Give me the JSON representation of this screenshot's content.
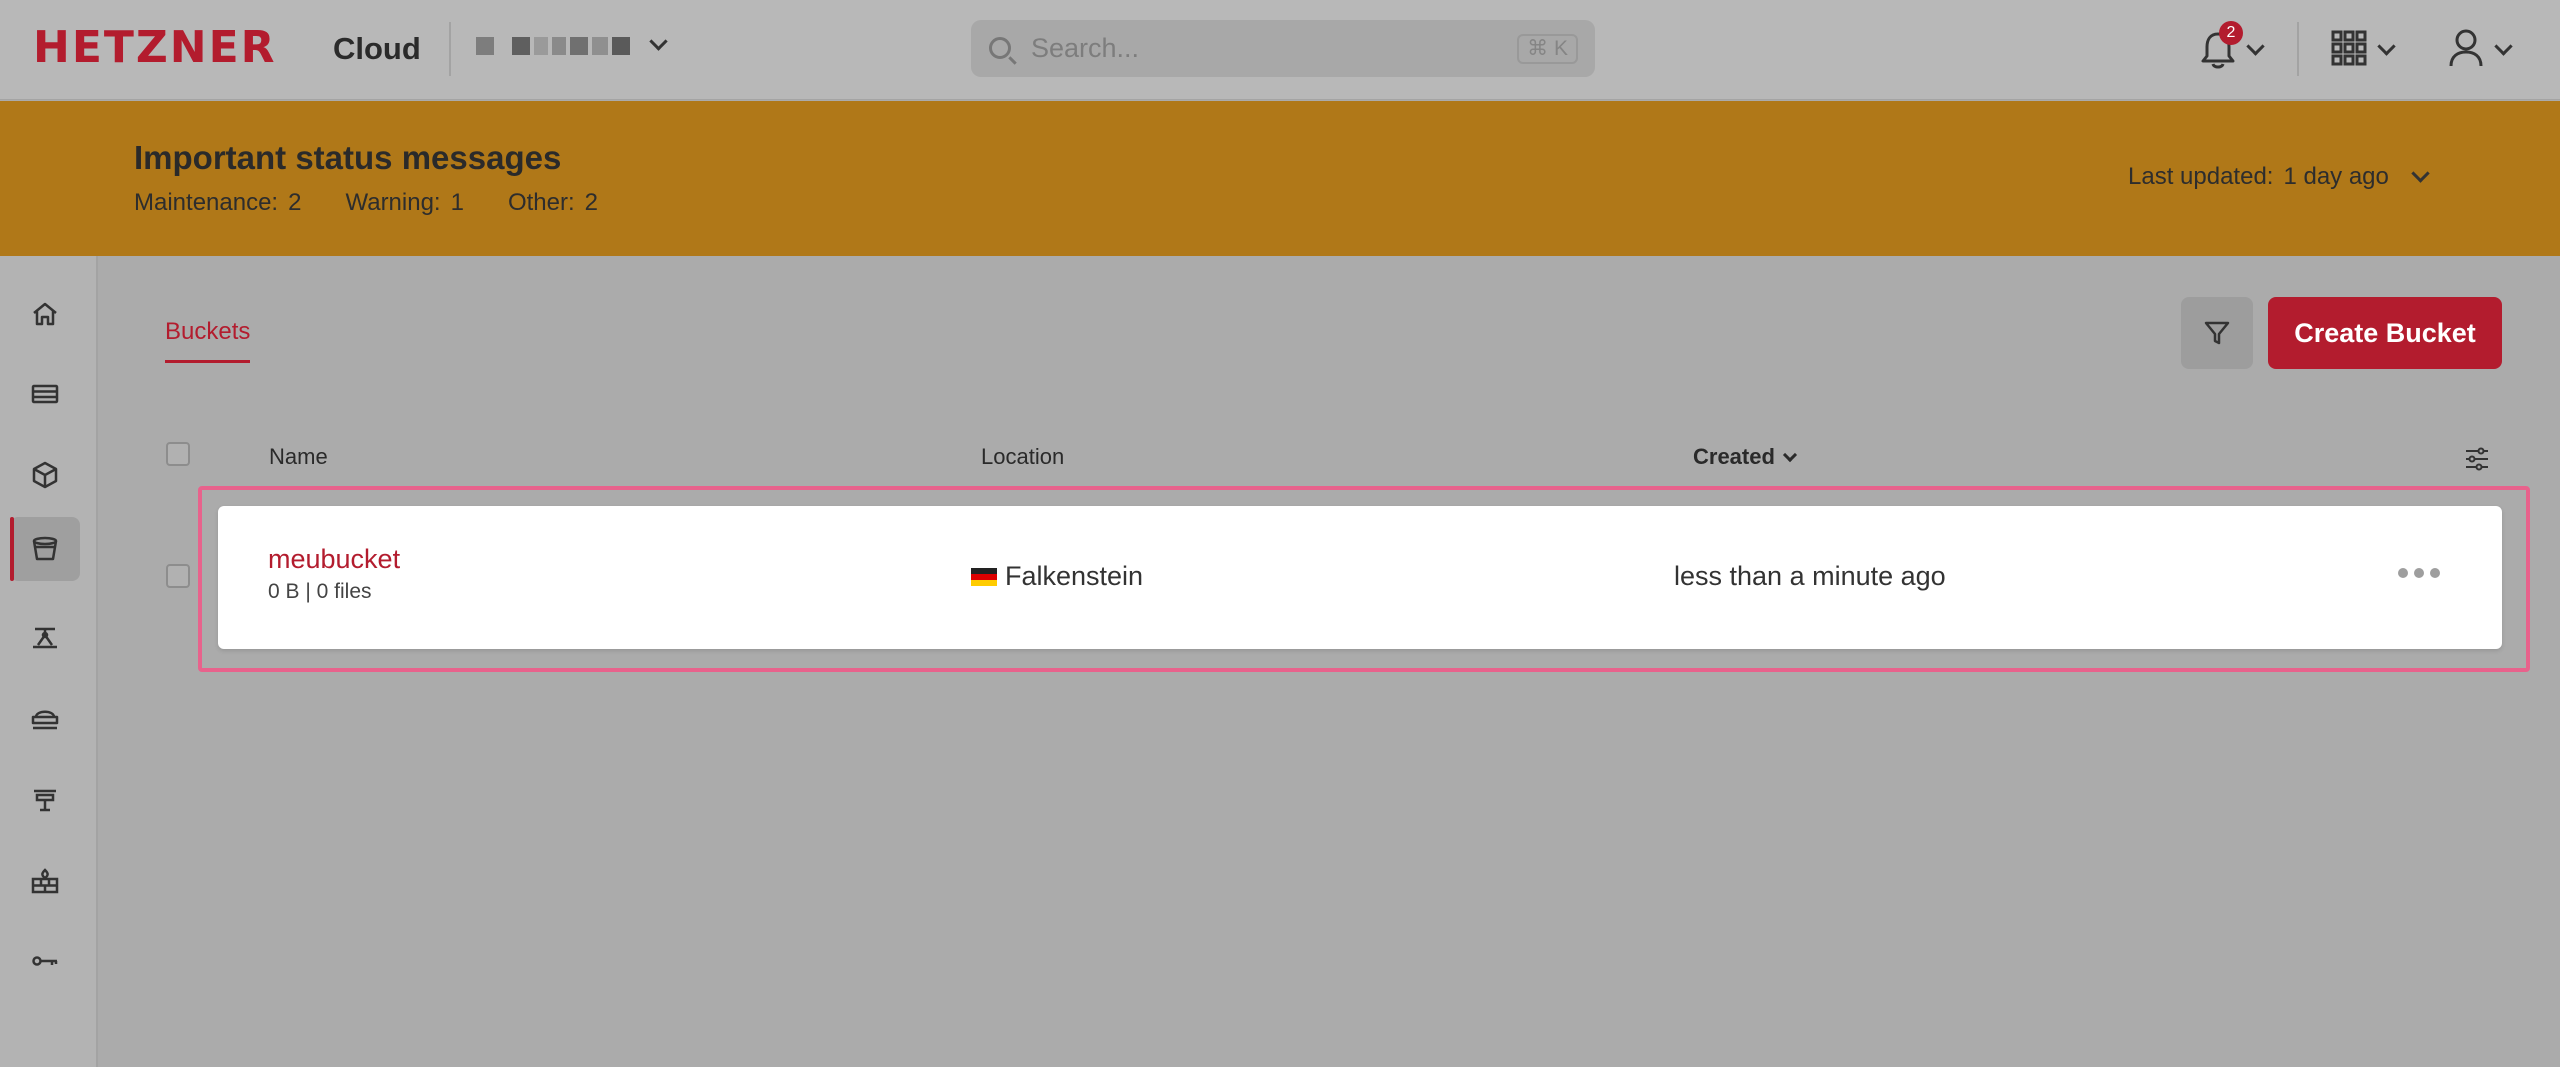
{
  "header": {
    "logo_text": "HETZNER",
    "logo_sub": "Cloud",
    "search_placeholder": "Search...",
    "search_shortcut": "⌘ K",
    "notification_count": "2"
  },
  "banner": {
    "title": "Important status messages",
    "maintenance_label": "Maintenance:",
    "maintenance_count": "2",
    "warning_label": "Warning:",
    "warning_count": "1",
    "other_label": "Other:",
    "other_count": "2",
    "updated_label": "Last updated:",
    "updated_value": "1 day ago"
  },
  "sidebar": {
    "items": [
      {
        "icon": "home-icon"
      },
      {
        "icon": "servers-icon"
      },
      {
        "icon": "volumes-icon"
      },
      {
        "icon": "bucket-icon",
        "active": true
      },
      {
        "icon": "load-balancer-icon"
      },
      {
        "icon": "networks-icon"
      },
      {
        "icon": "floating-ip-icon"
      },
      {
        "icon": "firewall-icon"
      },
      {
        "icon": "key-icon"
      }
    ]
  },
  "main": {
    "tab_label": "Buckets",
    "create_label": "Create Bucket",
    "columns": {
      "name": "Name",
      "location": "Location",
      "created": "Created"
    },
    "rows": [
      {
        "name": "meubucket",
        "meta": "0 B | 0 files",
        "location": "Falkenstein",
        "created": "less than a minute ago"
      }
    ]
  },
  "colors": {
    "brand": "#b31c2e",
    "banner": "#b07818",
    "highlight": "#e8628c"
  }
}
